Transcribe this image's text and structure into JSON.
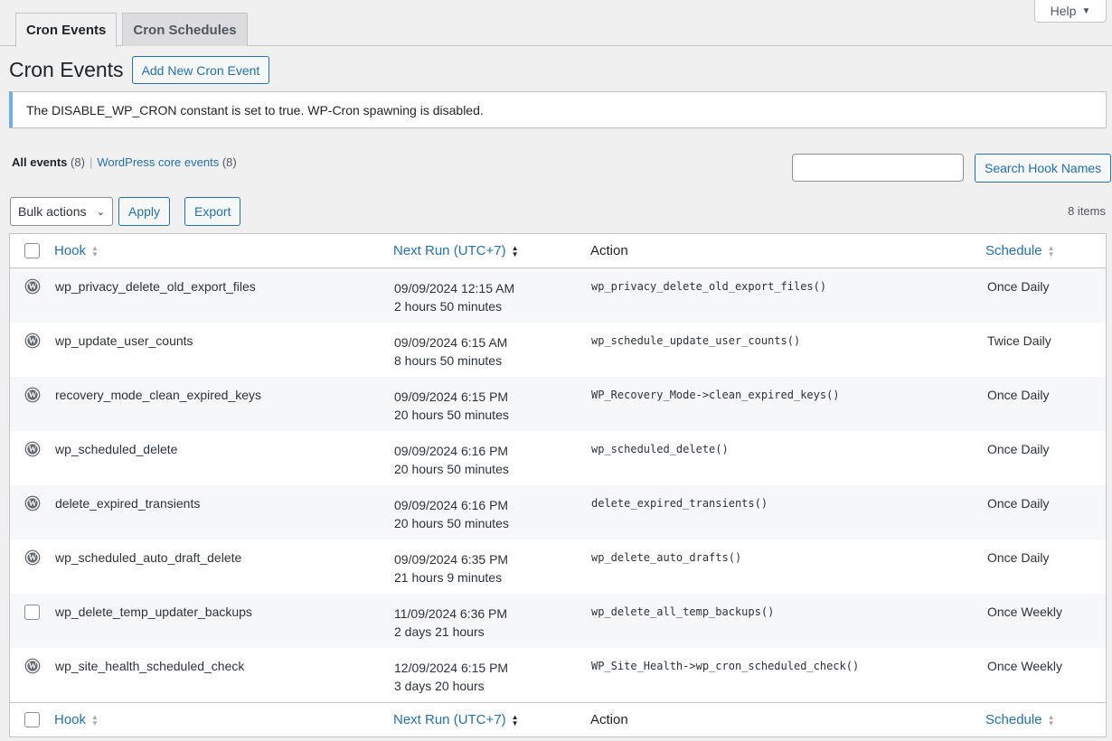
{
  "help": {
    "label": "Help"
  },
  "tabs": [
    {
      "label": "Cron Events",
      "active": true
    },
    {
      "label": "Cron Schedules",
      "active": false
    }
  ],
  "page": {
    "title": "Cron Events",
    "add_new_label": "Add New Cron Event"
  },
  "notice": {
    "text": "The DISABLE_WP_CRON constant is set to true. WP-Cron spawning is disabled."
  },
  "filters": {
    "all": {
      "label": "All events",
      "count": "(8)"
    },
    "core": {
      "label": "WordPress core events",
      "count": "(8)"
    },
    "separator": "|"
  },
  "search": {
    "value": "",
    "button_label": "Search Hook Names"
  },
  "toolbar": {
    "bulk_label": "Bulk actions",
    "apply_label": "Apply",
    "export_label": "Export",
    "items_count": "8 items"
  },
  "columns": {
    "hook": "Hook",
    "next_run": "Next Run (UTC+7)",
    "action": "Action",
    "schedule": "Schedule"
  },
  "rows": [
    {
      "icon": "wordpress-icon",
      "hook": "wp_privacy_delete_old_export_files",
      "next_run": "09/09/2024 12:15 AM",
      "relative": "2 hours 50 minutes",
      "action": "wp_privacy_delete_old_export_files()",
      "schedule": "Once Daily"
    },
    {
      "icon": "wordpress-icon",
      "hook": "wp_update_user_counts",
      "next_run": "09/09/2024 6:15 AM",
      "relative": "8 hours 50 minutes",
      "action": "wp_schedule_update_user_counts()",
      "schedule": "Twice Daily"
    },
    {
      "icon": "wordpress-icon",
      "hook": "recovery_mode_clean_expired_keys",
      "next_run": "09/09/2024 6:15 PM",
      "relative": "20 hours 50 minutes",
      "action": "WP_Recovery_Mode->clean_expired_keys()",
      "schedule": "Once Daily"
    },
    {
      "icon": "wordpress-icon",
      "hook": "wp_scheduled_delete",
      "next_run": "09/09/2024 6:16 PM",
      "relative": "20 hours 50 minutes",
      "action": "wp_scheduled_delete()",
      "schedule": "Once Daily"
    },
    {
      "icon": "wordpress-icon",
      "hook": "delete_expired_transients",
      "next_run": "09/09/2024 6:16 PM",
      "relative": "20 hours 50 minutes",
      "action": "delete_expired_transients()",
      "schedule": "Once Daily"
    },
    {
      "icon": "wordpress-icon",
      "hook": "wp_scheduled_auto_draft_delete",
      "next_run": "09/09/2024 6:35 PM",
      "relative": "21 hours 9 minutes",
      "action": "wp_delete_auto_drafts()",
      "schedule": "Once Daily"
    },
    {
      "icon": "checkbox",
      "hook": "wp_delete_temp_updater_backups",
      "next_run": "11/09/2024 6:36 PM",
      "relative": "2 days 21 hours",
      "action": "wp_delete_all_temp_backups()",
      "schedule": "Once Weekly"
    },
    {
      "icon": "wordpress-icon",
      "hook": "wp_site_health_scheduled_check",
      "next_run": "12/09/2024 6:15 PM",
      "relative": "3 days 20 hours",
      "action": "WP_Site_Health->wp_cron_scheduled_check()",
      "schedule": "Once Weekly"
    }
  ],
  "colors": {
    "accent": "#2271b1",
    "notice_border": "#72aee6"
  }
}
